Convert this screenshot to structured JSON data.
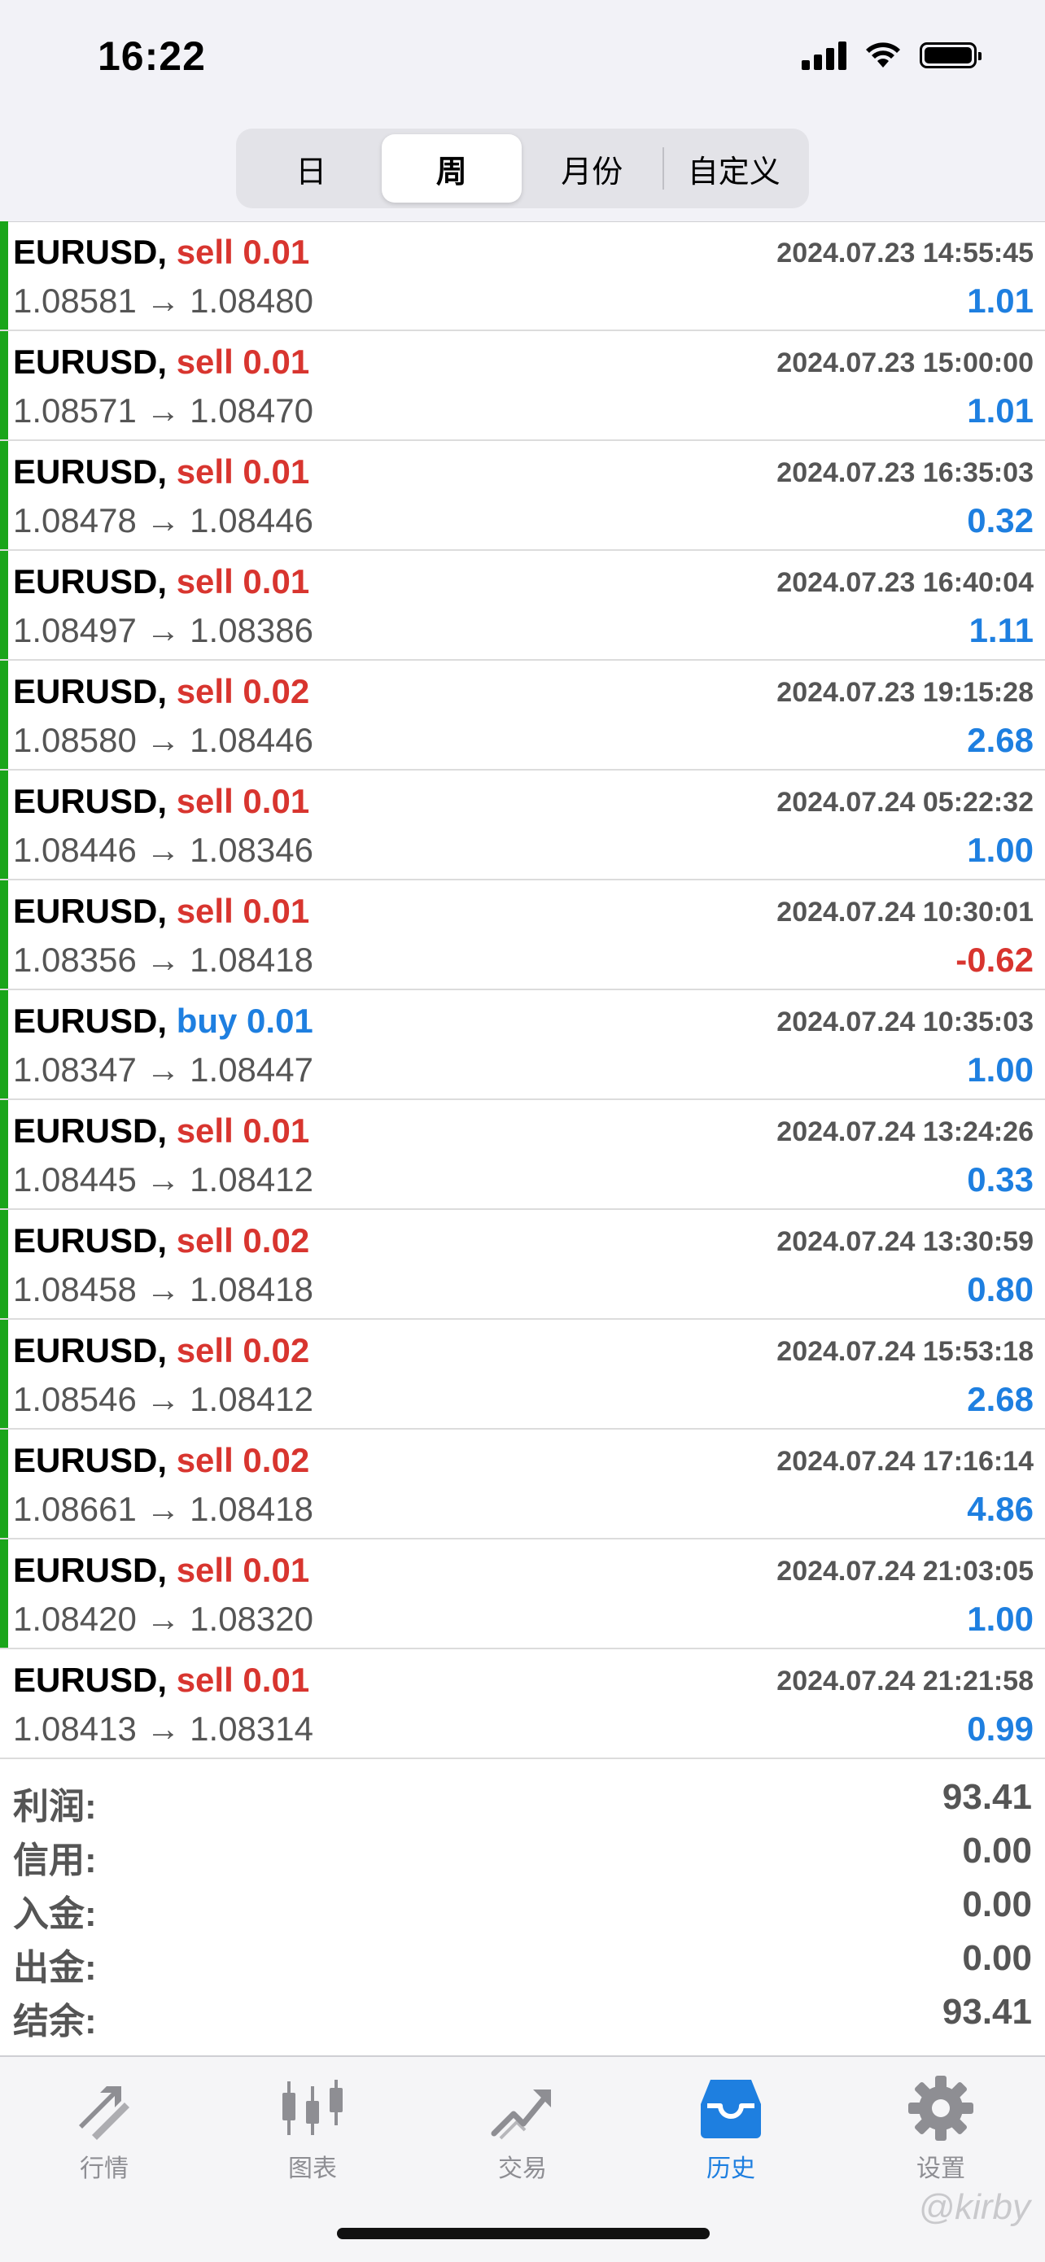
{
  "status_bar": {
    "time": "16:22"
  },
  "segments": [
    {
      "label": "日",
      "active": false
    },
    {
      "label": "周",
      "active": true
    },
    {
      "label": "月份",
      "active": false
    },
    {
      "label": "自定义",
      "active": false
    }
  ],
  "trades": [
    {
      "symbol": "EURUSD,",
      "side": "sell 0.01",
      "open": "1.08581",
      "close": "1.08480",
      "datetime": "2024.07.23 14:55:45",
      "profit": "1.01"
    },
    {
      "symbol": "EURUSD,",
      "side": "sell 0.01",
      "open": "1.08571",
      "close": "1.08470",
      "datetime": "2024.07.23 15:00:00",
      "profit": "1.01"
    },
    {
      "symbol": "EURUSD,",
      "side": "sell 0.01",
      "open": "1.08478",
      "close": "1.08446",
      "datetime": "2024.07.23 16:35:03",
      "profit": "0.32"
    },
    {
      "symbol": "EURUSD,",
      "side": "sell 0.01",
      "open": "1.08497",
      "close": "1.08386",
      "datetime": "2024.07.23 16:40:04",
      "profit": "1.11"
    },
    {
      "symbol": "EURUSD,",
      "side": "sell 0.02",
      "open": "1.08580",
      "close": "1.08446",
      "datetime": "2024.07.23 19:15:28",
      "profit": "2.68"
    },
    {
      "symbol": "EURUSD,",
      "side": "sell 0.01",
      "open": "1.08446",
      "close": "1.08346",
      "datetime": "2024.07.24 05:22:32",
      "profit": "1.00"
    },
    {
      "symbol": "EURUSD,",
      "side": "sell 0.01",
      "open": "1.08356",
      "close": "1.08418",
      "datetime": "2024.07.24 10:30:01",
      "profit": "-0.62"
    },
    {
      "symbol": "EURUSD,",
      "side": "buy 0.01",
      "open": "1.08347",
      "close": "1.08447",
      "datetime": "2024.07.24 10:35:03",
      "profit": "1.00"
    },
    {
      "symbol": "EURUSD,",
      "side": "sell 0.01",
      "open": "1.08445",
      "close": "1.08412",
      "datetime": "2024.07.24 13:24:26",
      "profit": "0.33"
    },
    {
      "symbol": "EURUSD,",
      "side": "sell 0.02",
      "open": "1.08458",
      "close": "1.08418",
      "datetime": "2024.07.24 13:30:59",
      "profit": "0.80"
    },
    {
      "symbol": "EURUSD,",
      "side": "sell 0.02",
      "open": "1.08546",
      "close": "1.08412",
      "datetime": "2024.07.24 15:53:18",
      "profit": "2.68"
    },
    {
      "symbol": "EURUSD,",
      "side": "sell 0.02",
      "open": "1.08661",
      "close": "1.08418",
      "datetime": "2024.07.24 17:16:14",
      "profit": "4.86"
    },
    {
      "symbol": "EURUSD,",
      "side": "sell 0.01",
      "open": "1.08420",
      "close": "1.08320",
      "datetime": "2024.07.24 21:03:05",
      "profit": "1.00"
    },
    {
      "symbol": "EURUSD,",
      "side": "sell 0.01",
      "open": "1.08413",
      "close": "1.08314",
      "datetime": "2024.07.24 21:21:58",
      "profit": "0.99"
    }
  ],
  "summary": [
    {
      "label": "利润:",
      "value": "93.41"
    },
    {
      "label": "信用:",
      "value": "0.00"
    },
    {
      "label": "入金:",
      "value": "0.00"
    },
    {
      "label": "出金:",
      "value": "0.00"
    },
    {
      "label": "结余:",
      "value": "93.41"
    }
  ],
  "tab_bar": [
    {
      "label": "行情",
      "icon": "quotes-arrows-icon",
      "active": false
    },
    {
      "label": "图表",
      "icon": "candlestick-chart-icon",
      "active": false
    },
    {
      "label": "交易",
      "icon": "trade-trend-icon",
      "active": false
    },
    {
      "label": "历史",
      "icon": "history-inbox-icon",
      "active": true
    },
    {
      "label": "设置",
      "icon": "gear-icon",
      "active": false
    }
  ],
  "watermark": "@kirby",
  "colors": {
    "sell": "#d8352f",
    "buy": "#1e7fe0",
    "profit_positive": "#1e7fe0",
    "profit_negative": "#d8352f",
    "row_indicator": "#1aa51a",
    "tab_active": "#1e7fe0",
    "tab_inactive": "#8e8e93"
  }
}
